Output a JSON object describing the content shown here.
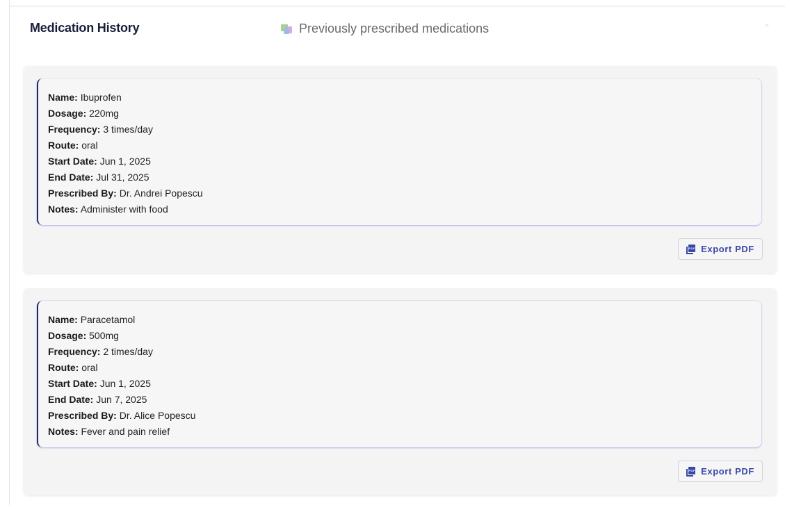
{
  "section": {
    "title": "Medication History",
    "subtitle": "Previously prescribed medications",
    "subtitle_icon": "pills-icon",
    "collapse_glyph": "^"
  },
  "labels": {
    "name": "Name:",
    "dosage": "Dosage:",
    "frequency": "Frequency:",
    "route": "Route:",
    "start_date": "Start Date:",
    "end_date": "End Date:",
    "prescribed_by": "Prescribed By:",
    "notes": "Notes:"
  },
  "medications": [
    {
      "name": "Ibuprofen",
      "dosage": "220mg",
      "frequency": "3 times/day",
      "route": "oral",
      "start_date": "Jun 1, 2025",
      "end_date": "Jul 31, 2025",
      "prescribed_by": "Dr. Andrei Popescu",
      "notes": "Administer with food",
      "export_label": "Export PDF"
    },
    {
      "name": "Paracetamol",
      "dosage": "500mg",
      "frequency": "2 times/day",
      "route": "oral",
      "start_date": "Jun 1, 2025",
      "end_date": "Jun 7, 2025",
      "prescribed_by": "Dr. Alice Popescu",
      "notes": "Fever and pain relief",
      "export_label": "Export PDF"
    }
  ],
  "colors": {
    "accent": "#3a47a8",
    "card_border": "#1d2a5e",
    "title": "#1b1f3b"
  }
}
